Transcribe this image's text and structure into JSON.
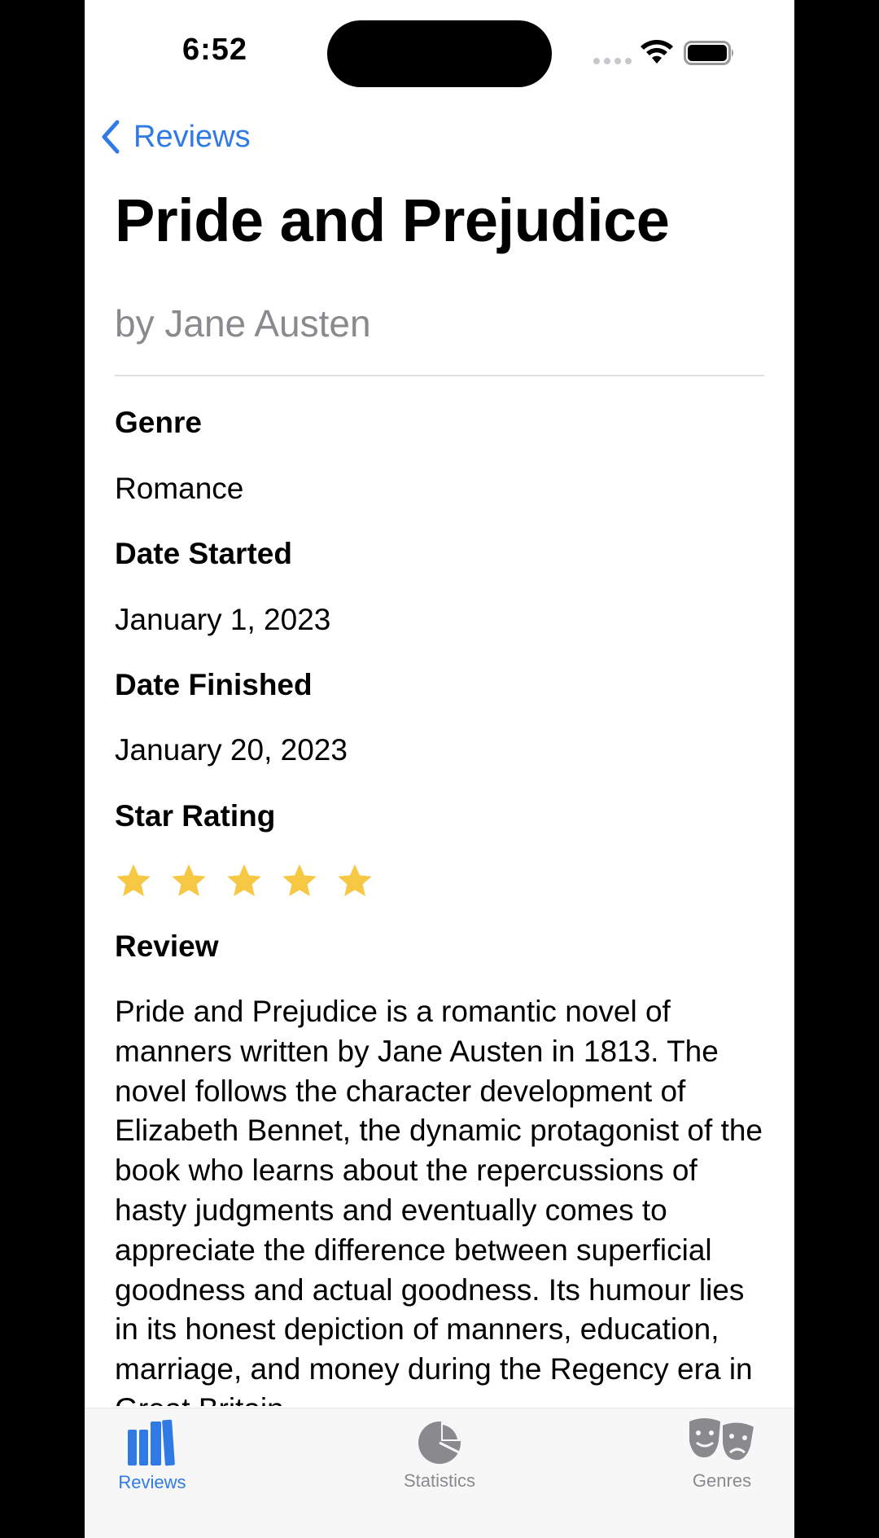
{
  "status_bar": {
    "time": "6:52"
  },
  "nav": {
    "back_label": "Reviews"
  },
  "book": {
    "title": "Pride and Prejudice",
    "author": "by Jane Austen",
    "genre_label": "Genre",
    "genre_value": "Romance",
    "date_started_label": "Date Started",
    "date_started_value": "January 1, 2023",
    "date_finished_label": "Date Finished",
    "date_finished_value": "January 20, 2023",
    "star_rating_label": "Star Rating",
    "star_rating": 5,
    "star_rating_max": 5,
    "review_label": "Review",
    "review_text": "Pride and Prejudice is a romantic novel of manners written by Jane Austen in 1813. The novel follows the character development of Elizabeth Bennet, the dynamic protagonist of the book who learns about the repercussions of hasty judgments and eventually comes to appreciate the difference between superficial goodness and actual goodness. Its humour lies in its honest depiction of manners, education, marriage, and money during the Regency era in Great Britain."
  },
  "tab_bar": {
    "tabs": [
      {
        "label": "Reviews",
        "icon": "books-icon",
        "active": true
      },
      {
        "label": "Statistics",
        "icon": "pie-chart-icon",
        "active": false
      },
      {
        "label": "Genres",
        "icon": "theater-masks-icon",
        "active": false
      }
    ]
  },
  "colors": {
    "accent": "#2f7ae5",
    "star": "#f7c844",
    "secondary_text": "#8a8a8e",
    "tab_bar_bg": "#f7f7f7"
  }
}
